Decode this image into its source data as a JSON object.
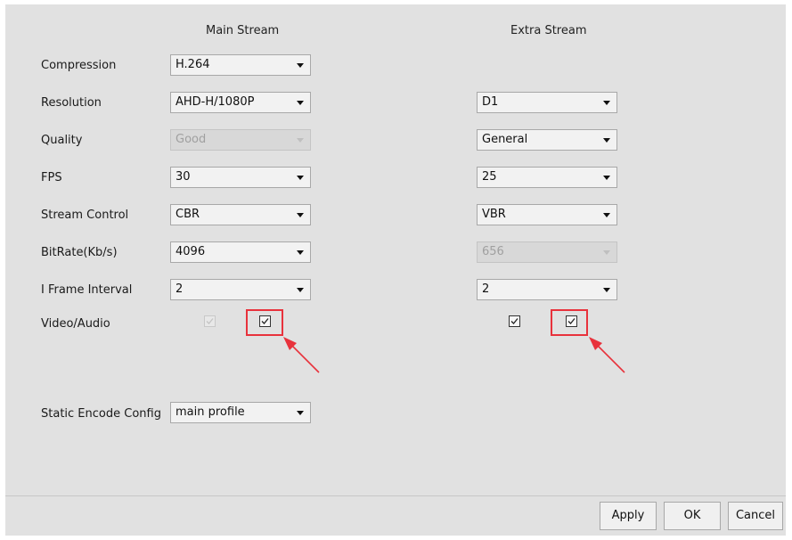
{
  "headers": {
    "main_stream": "Main Stream",
    "extra_stream": "Extra Stream"
  },
  "labels": {
    "compression": "Compression",
    "resolution": "Resolution",
    "quality": "Quality",
    "fps": "FPS",
    "stream_control": "Stream Control",
    "bitrate": "BitRate(Kb/s)",
    "iframe_interval": "I Frame Interval",
    "video_audio": "Video/Audio",
    "static_encode_config": "Static Encode Config"
  },
  "main": {
    "compression": "H.264",
    "resolution": "AHD-H/1080P",
    "quality": "Good",
    "fps": "30",
    "stream_control": "CBR",
    "bitrate": "4096",
    "iframe_interval": "2",
    "video_checked": true,
    "audio_checked": true
  },
  "extra": {
    "resolution": "D1",
    "quality": "General",
    "fps": "25",
    "stream_control": "VBR",
    "bitrate": "656",
    "iframe_interval": "2",
    "video_checked": true,
    "audio_checked": true
  },
  "static_encode_config": "main profile",
  "buttons": {
    "apply": "Apply",
    "ok": "OK",
    "cancel": "Cancel"
  },
  "colors": {
    "annotation_red": "#e8323c",
    "panel_bg": "#e1e1e1"
  },
  "icons": {
    "checkmark": "check-icon",
    "dropdown": "chevron-down-icon",
    "annotation": "arrow-icon"
  }
}
